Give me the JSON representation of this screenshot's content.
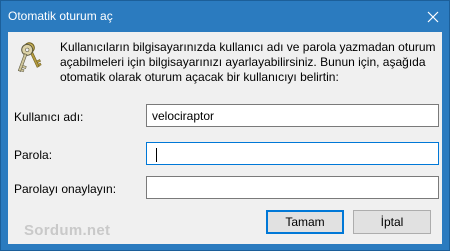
{
  "window": {
    "title": "Otomatik oturum aç",
    "close_icon": "close-icon"
  },
  "dialog": {
    "icon": "keys-icon",
    "description_line1": "Kullanıcıların bilgisayarınızda kullanıcı adı ve parola yazmadan oturum",
    "description_line2": "açabilmeleri için bilgisayarınızı ayarlayabilirsiniz. Bunun için, aşağıda",
    "description_line3": "otomatik olarak oturum açacak bir kullanıcıyı belirtin:"
  },
  "form": {
    "username_label": "Kullanıcı adı:",
    "username_value": "velociraptor",
    "password_label": "Parola:",
    "password_value": "",
    "confirm_label": "Parolayı onaylayın:",
    "confirm_value": ""
  },
  "buttons": {
    "ok_label": "Tamam",
    "cancel_label": "İptal"
  },
  "watermark": "Sordum.net",
  "colors": {
    "titlebar": "#2b7bbf",
    "client": "#f0f0f0",
    "focus": "#0078d7"
  }
}
